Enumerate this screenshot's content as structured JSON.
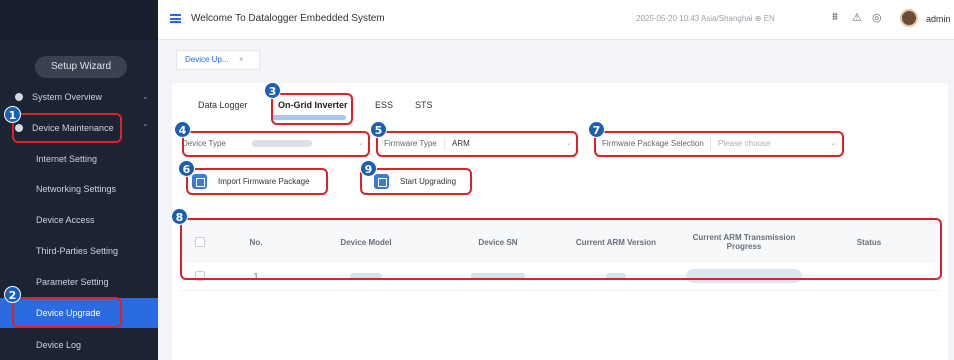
{
  "header": {
    "title": "Welcome To Datalogger Embedded System",
    "datetime": "2025-05-20 10:43 Asia/Shanghai",
    "language": "EN",
    "user": "admin"
  },
  "breadcrumb": {
    "tab_label": "Device Up...",
    "close_glyph": "×"
  },
  "sidebar": {
    "wizard_label": "Setup Wizard",
    "items": [
      {
        "label": "System Overview",
        "icon": "dashboard-icon"
      },
      {
        "label": "Device Maintenance",
        "icon": "maintenance-icon"
      },
      {
        "label": "Internet Setting"
      },
      {
        "label": "Networking Settings"
      },
      {
        "label": "Device Access"
      },
      {
        "label": "Third-Parties Setting"
      },
      {
        "label": "Parameter Setting"
      },
      {
        "label": "Device Upgrade"
      },
      {
        "label": "Device Log"
      }
    ]
  },
  "tabs": [
    {
      "label": "Data Logger"
    },
    {
      "label": "On-Grid Inverter"
    },
    {
      "label": "ESS"
    },
    {
      "label": "STS"
    }
  ],
  "filters": {
    "device_type_label": "Device Type",
    "firmware_type_label": "Firmware Type",
    "firmware_type_value": "ARM",
    "package_label": "Firmware Package Selection",
    "package_placeholder": "Please choose"
  },
  "buttons": {
    "import": "Import Firmware Package",
    "start": "Start Upgrading"
  },
  "table": {
    "columns": [
      "No.",
      "Device Model",
      "Device SN",
      "Current ARM Version",
      "Current ARM Transmission Progress",
      "Status"
    ],
    "rows": [
      {
        "no": "1"
      }
    ]
  },
  "annotations": [
    "1",
    "2",
    "3",
    "4",
    "5",
    "6",
    "7",
    "8",
    "9"
  ],
  "colors": {
    "accent": "#2a6ce0",
    "annotation": "#d8232a",
    "badge": "#1a5fb4",
    "sidebar": "#1c2433"
  }
}
